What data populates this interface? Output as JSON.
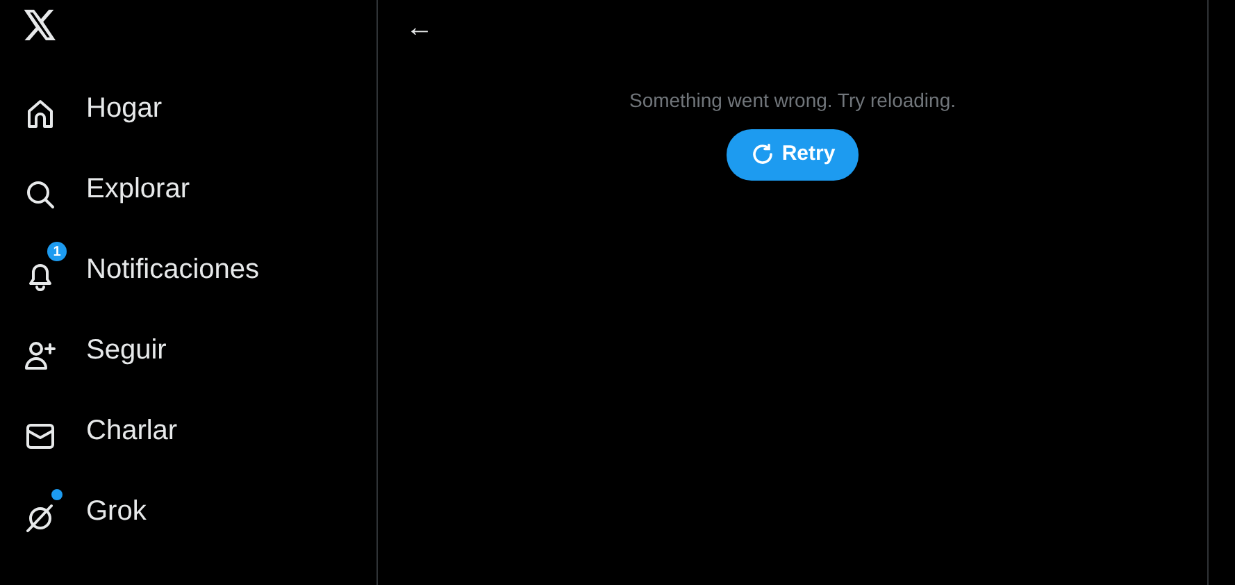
{
  "sidebar": {
    "items": [
      {
        "label": "Hogar",
        "dot": false
      },
      {
        "label": "Explorar",
        "dot": false
      },
      {
        "label": "Notificaciones",
        "badge": "1",
        "dot": false
      },
      {
        "label": "Seguir",
        "dot": false
      },
      {
        "label": "Charlar",
        "dot": false
      },
      {
        "label": "Grok",
        "dot": true
      }
    ]
  },
  "main": {
    "back": "←",
    "message": "Something went wrong. Try reloading.",
    "retry_button": "Retry"
  }
}
